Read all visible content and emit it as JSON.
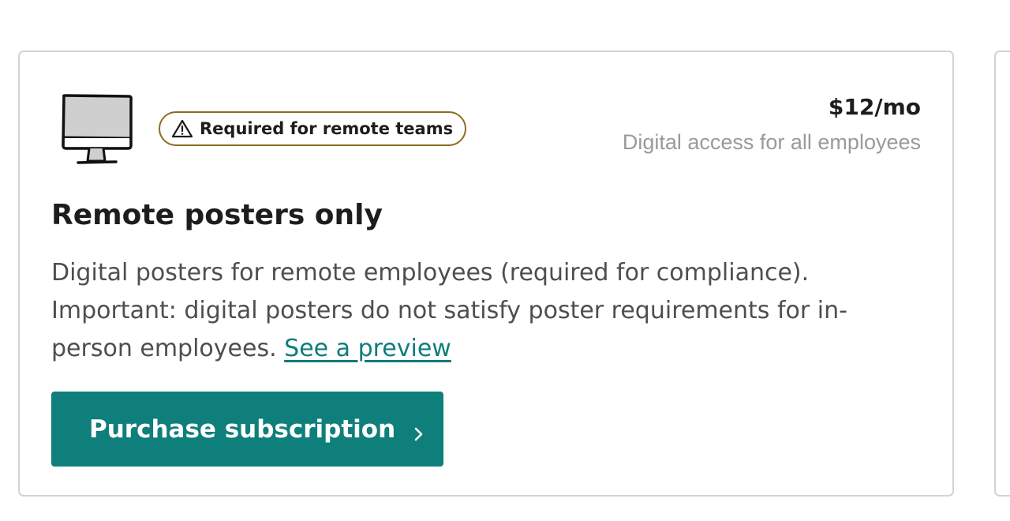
{
  "card": {
    "icon": "desktop-monitor-icon",
    "badge": {
      "icon": "warning-triangle-icon",
      "label": "Required for remote teams",
      "border_color": "#8a6d1e"
    },
    "price": "$12/mo",
    "price_subtitle": "Digital access for all employees",
    "title": "Remote posters only",
    "description": "Digital posters for remote employees (required for compliance). Important: digital posters do not satisfy poster requirements for in-person employees.",
    "preview_link": "See a preview",
    "purchase_button": {
      "label": "Purchase subscription",
      "icon": "chevron-right-icon",
      "color": "#0f7f7c"
    }
  },
  "colors": {
    "accent": "#0f7f7c",
    "link": "#0f7d7b",
    "text": "#1d1d1d",
    "muted": "#9a9a9a"
  }
}
